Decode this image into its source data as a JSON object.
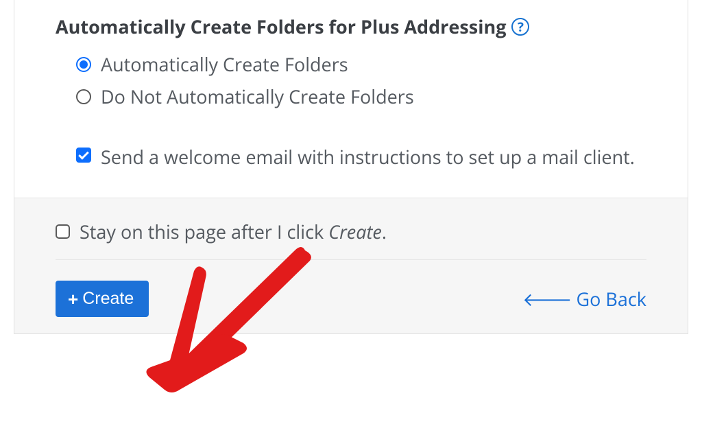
{
  "section": {
    "heading": "Automatically Create Folders for Plus Addressing",
    "radios": [
      {
        "label": "Automatically Create Folders",
        "selected": true
      },
      {
        "label": "Do Not Automatically Create Folders",
        "selected": false
      }
    ],
    "welcome_checkbox": {
      "label": "Send a welcome email with instructions to set up a mail client.",
      "checked": true
    }
  },
  "footer": {
    "stay_checkbox": {
      "prefix": "Stay on this page after I click ",
      "emphasis": "Create",
      "suffix": ".",
      "checked": false
    },
    "create_button": "Create",
    "goback_link": "Go Back"
  },
  "colors": {
    "accent": "#1c71d8",
    "text": "#555a60",
    "heading": "#3b3f44"
  }
}
